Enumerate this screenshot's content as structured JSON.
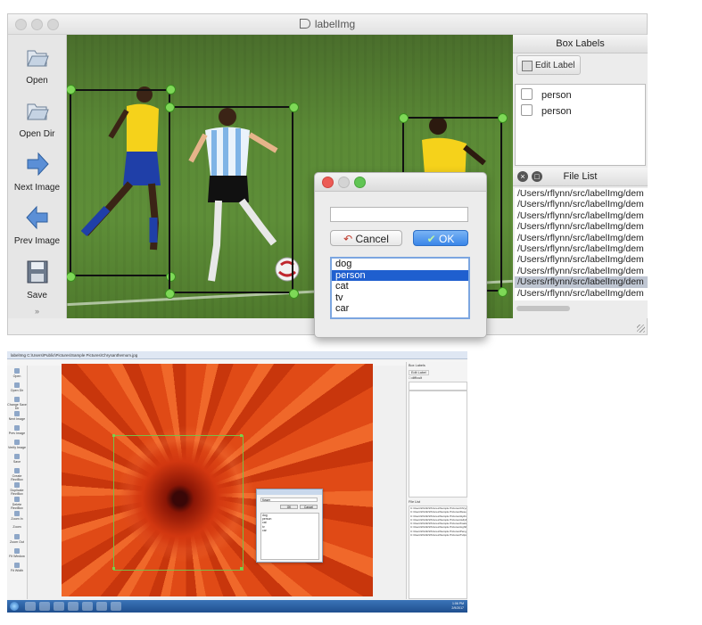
{
  "mac": {
    "title": "labelImg",
    "toolbar": [
      "Open",
      "Open Dir",
      "Next Image",
      "Prev Image",
      "Save"
    ],
    "dock_labels": "Box Labels",
    "edit_label": "Edit Label",
    "labels": [
      "person",
      "person"
    ],
    "dock_files": "File List",
    "files": [
      "/Users/rflynn/src/labelImg/dem",
      "/Users/rflynn/src/labelImg/dem",
      "/Users/rflynn/src/labelImg/dem",
      "/Users/rflynn/src/labelImg/dem",
      "/Users/rflynn/src/labelImg/dem",
      "/Users/rflynn/src/labelImg/dem",
      "/Users/rflynn/src/labelImg/dem",
      "/Users/rflynn/src/labelImg/dem",
      "/Users/rflynn/src/labelImg/dem",
      "/Users/rflynn/src/labelImg/dem"
    ],
    "dialog": {
      "input_value": "",
      "cancel": "Cancel",
      "ok": "OK",
      "options": [
        "dog",
        "person",
        "cat",
        "tv",
        "car"
      ],
      "selected": "person"
    },
    "colors": {
      "box_handle": "#7ed957",
      "ok_button": "#3a86e8",
      "selection": "#1f5fcf"
    }
  },
  "win": {
    "title": "labelImg C:\\Users\\Public\\Pictures\\Sample Pictures\\Chrysanthemum.jpg",
    "toolbar": [
      "Open",
      "Open Dir",
      "Change Save Dir",
      "Next Image",
      "Prev Image",
      "Verify Image",
      "Save",
      "Create RectBox",
      "Duplicate RectBox",
      "Delete RectBox",
      "Zoom In",
      "Zoom",
      "Zoom Out",
      "Fit Window",
      "Fit Width"
    ],
    "dock_labels": "Box Labels",
    "edit_label": "Edit Label",
    "difficult": "difficult",
    "use_default": "Use default label",
    "dock_files": "File List",
    "dialog_input": "flower",
    "dialog_ok": "OK",
    "dialog_cancel": "Cancel",
    "options": [
      "dog",
      "person",
      "cat",
      "tv",
      "car"
    ],
    "files": [
      "C:\\Users\\Public\\Pictures\\Sample Pictures\\Chrysanthemum.jpg",
      "C:\\Users\\Public\\Pictures\\Sample Pictures\\Desert.jpg",
      "C:\\Users\\Public\\Pictures\\Sample Pictures\\Hydrangeas.jpg",
      "C:\\Users\\Public\\Pictures\\Sample Pictures\\Jellyfish.jpg",
      "C:\\Users\\Public\\Pictures\\Sample Pictures\\Koala.jpg",
      "C:\\Users\\Public\\Pictures\\Sample Pictures\\Lighthouse.jpg",
      "C:\\Users\\Public\\Pictures\\Sample Pictures\\Penguins.jpg",
      "C:\\Users\\Public\\Pictures\\Sample Pictures\\Tulips.jpg"
    ],
    "clock": [
      "1:06 PM",
      "2/9/2017"
    ]
  }
}
